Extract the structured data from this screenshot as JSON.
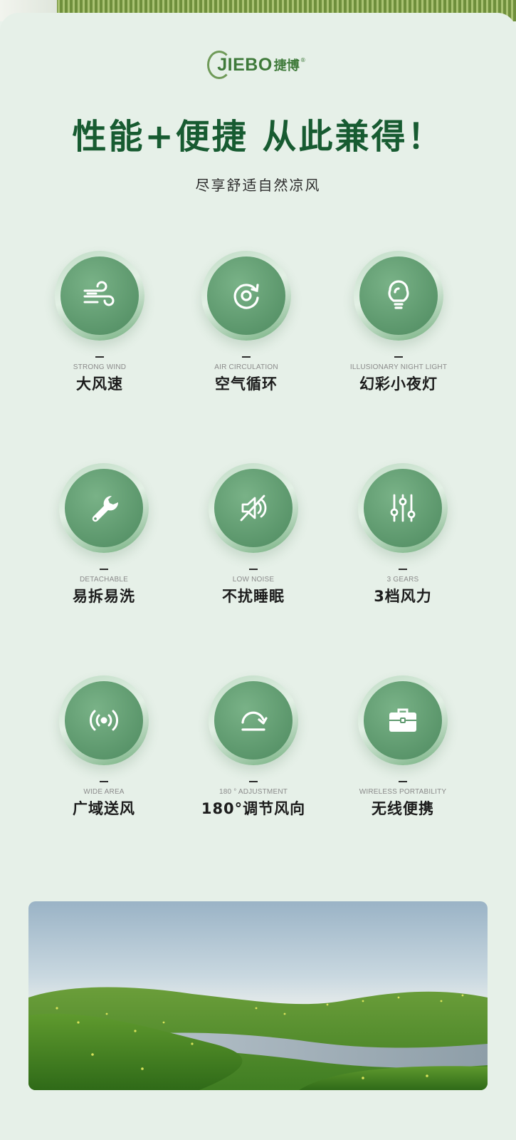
{
  "brand": {
    "name": "JIEBO",
    "name_cn": "捷博",
    "registered": "®"
  },
  "headline": "性能+便捷 从此兼得！",
  "subhead": "尽享舒适自然凉风",
  "colors": {
    "headline": "#175b31",
    "icon_disc": "#5f9a6f",
    "background": "#e6f0e8"
  },
  "features": [
    {
      "icon": "wind-icon",
      "dash": "–",
      "en": "STRONG WIND",
      "cn": "大风速"
    },
    {
      "icon": "air-circulation-icon",
      "dash": "–",
      "en": "AIR CIRCULATION",
      "cn": "空气循环"
    },
    {
      "icon": "lightbulb-icon",
      "dash": "–",
      "en": "ILLUSIONARY NIGHT LIGHT",
      "cn": "幻彩小夜灯"
    },
    {
      "icon": "wrench-icon",
      "dash": "–",
      "en": "DETACHABLE",
      "cn": "易拆易洗"
    },
    {
      "icon": "mute-speaker-icon",
      "dash": "–",
      "en": "LOW NOISE",
      "cn": "不扰睡眠"
    },
    {
      "icon": "sliders-icon",
      "dash": "–",
      "en": "3 GEARS",
      "cn": "3档风力"
    },
    {
      "icon": "wireless-signal-icon",
      "dash": "–",
      "en": "WIDE AREA",
      "cn": "广域送风"
    },
    {
      "icon": "rotate-180-icon",
      "dash": "–",
      "en": "180 ° ADJUSTMENT",
      "cn": "180°调节风向"
    },
    {
      "icon": "briefcase-icon",
      "dash": "–",
      "en": "WIRELESS PORTABILITY",
      "cn": "无线便携"
    }
  ]
}
